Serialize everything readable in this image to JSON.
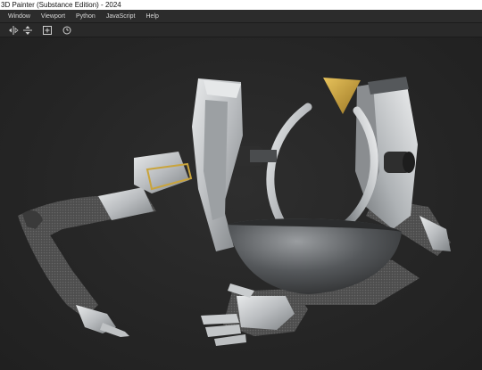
{
  "window": {
    "title": "3D Painter (Substance Edition) - 2024"
  },
  "menubar": {
    "items": [
      {
        "label": "Window"
      },
      {
        "label": "Viewport"
      },
      {
        "label": "Python"
      },
      {
        "label": "JavaScript"
      },
      {
        "label": "Help"
      }
    ]
  },
  "toolbar": {
    "tools": [
      {
        "icon": "mirror-symmetry-icon"
      },
      {
        "icon": "align-axis-icon"
      },
      {
        "icon": "add-frame-icon"
      },
      {
        "icon": "reset-view-icon"
      }
    ]
  },
  "viewport": {
    "background": "#262626",
    "model_colors": {
      "metal": "#c9ccce",
      "dark_metal": "#3a3a3a",
      "gold": "#c9a43c",
      "mesh": "#4a4a4a"
    }
  }
}
